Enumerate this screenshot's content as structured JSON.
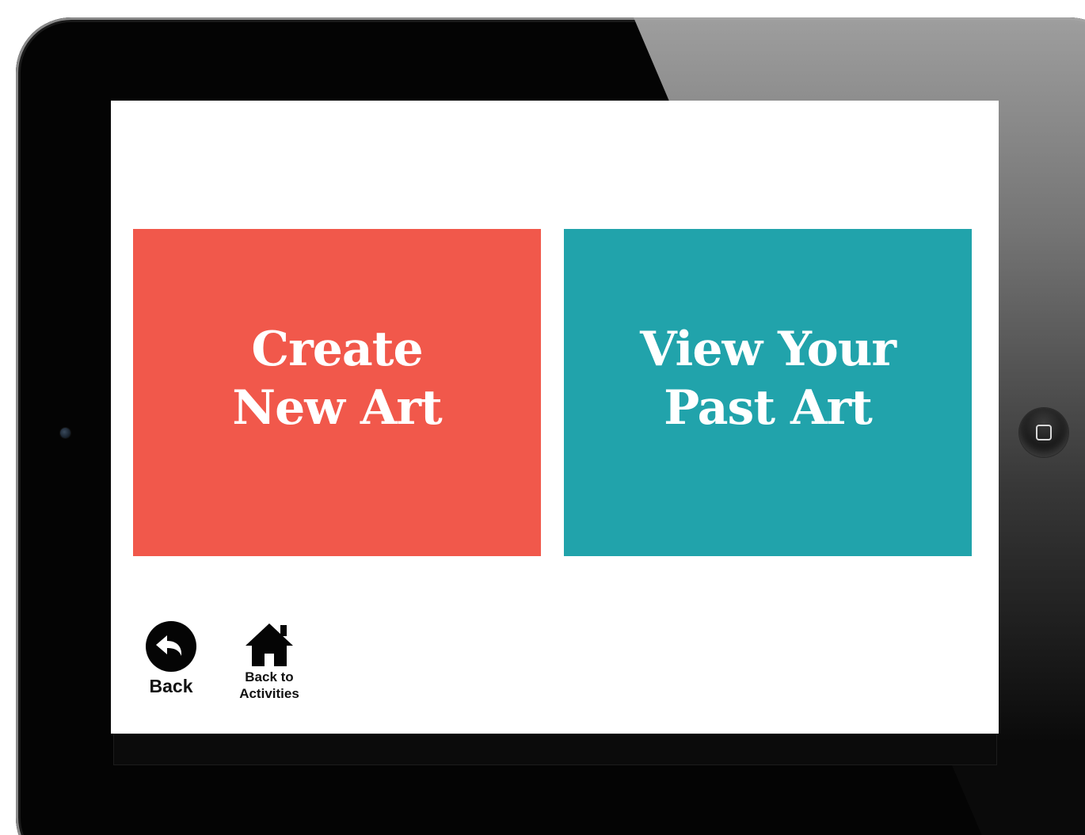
{
  "tiles": {
    "create": {
      "line1": "Create",
      "line2": "New Art",
      "color": "#f1584b"
    },
    "view": {
      "line1": "View Your",
      "line2": "Past Art",
      "color": "#21a3ab"
    }
  },
  "nav": {
    "back": {
      "label": "Back",
      "icon": "back-arrow-circle-icon"
    },
    "home": {
      "label_line1": "Back to",
      "label_line2": "Activities",
      "icon": "house-icon"
    }
  }
}
